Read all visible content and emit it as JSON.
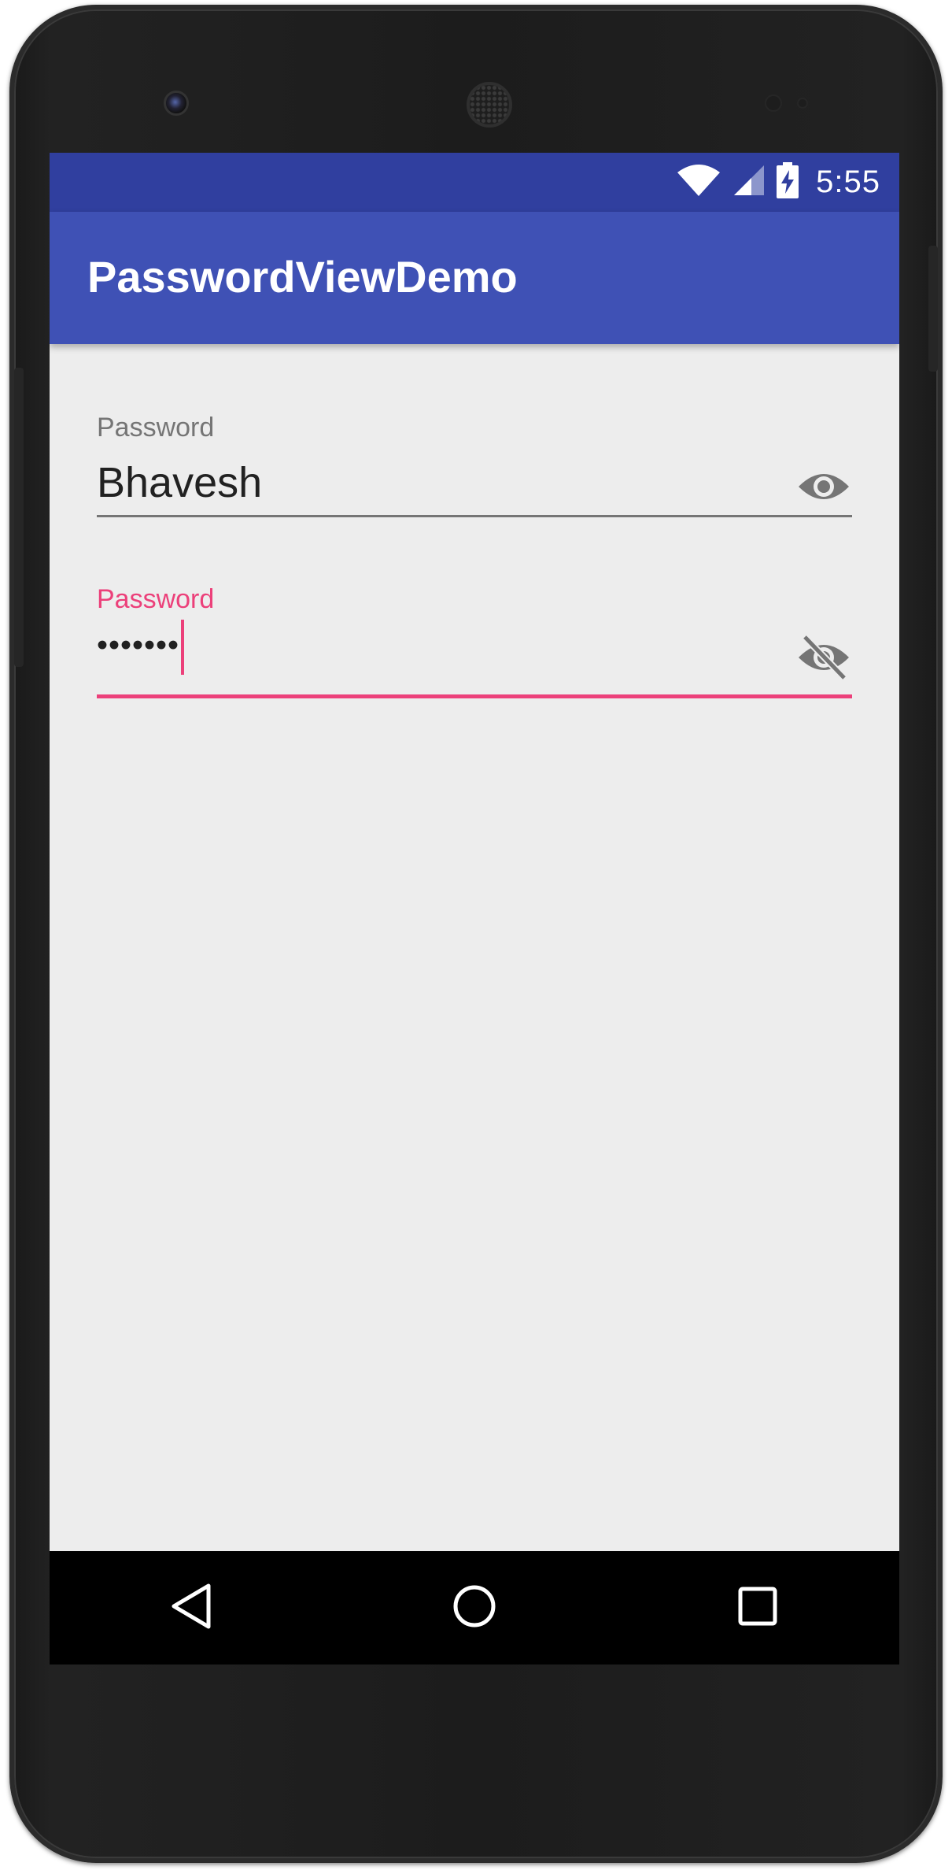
{
  "status_bar": {
    "time": "5:55",
    "icons": [
      "wifi-icon",
      "cell-signal-icon",
      "battery-charging-icon"
    ]
  },
  "app_bar": {
    "title": "PasswordViewDemo"
  },
  "fields": [
    {
      "label": "Password",
      "value": "Bhavesh",
      "visible": true,
      "toggle_icon": "eye-icon",
      "focused": false
    },
    {
      "label": "Password",
      "value": "•••••••",
      "visible": false,
      "toggle_icon": "eye-off-icon",
      "focused": true
    }
  ],
  "nav_bar": {
    "buttons": [
      "back-icon",
      "home-icon",
      "recents-icon"
    ]
  },
  "colors": {
    "status_bar": "#303f9f",
    "app_bar": "#3f51b5",
    "accent": "#ec407a",
    "background": "#ededed"
  }
}
